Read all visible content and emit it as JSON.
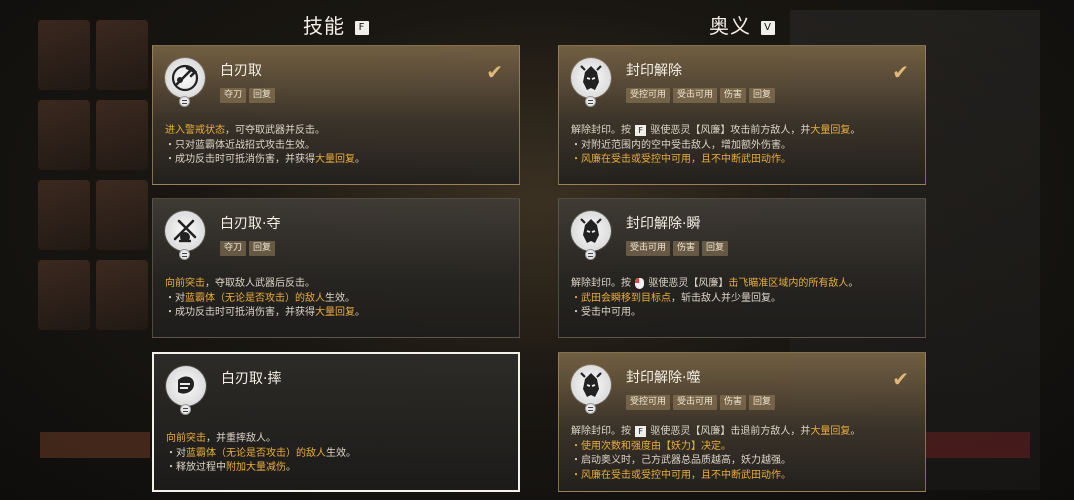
{
  "headers": {
    "skills": {
      "label": "技能",
      "key": "F"
    },
    "arcana": {
      "label": "奥义",
      "key": "V"
    }
  },
  "colors": {
    "gold": "#e9ae3c",
    "blue": "#7fb3e6",
    "check": "#e0b97a"
  },
  "skills": [
    {
      "title": "白刃取",
      "tags": [
        "夺刀",
        "回复"
      ],
      "selected": true,
      "icon": "blade-grab-icon",
      "lines": [
        [
          {
            "t": "进入警戒状态",
            "c": "gold"
          },
          {
            "t": "，可夺取武器并反击。"
          }
        ],
        [
          {
            "t": "・只对蓝霸体近战招式攻击生效。"
          }
        ],
        [
          {
            "t": "・成功反击时可抵消伤害，并获得"
          },
          {
            "t": "大量回复",
            "c": "gold"
          },
          {
            "t": "。"
          }
        ]
      ]
    },
    {
      "title": "白刃取·夺",
      "tags": [
        "夺刀",
        "回复"
      ],
      "selected": false,
      "icon": "blade-snatch-icon",
      "lines": [
        [
          {
            "t": "向前突击",
            "c": "gold"
          },
          {
            "t": "，夺取敌人武器后反击。"
          }
        ],
        [
          {
            "t": "・对"
          },
          {
            "t": "蓝霸体（无论是否攻击）的敌人",
            "c": "gold"
          },
          {
            "t": "生效。"
          }
        ],
        [
          {
            "t": "・成功反击时可抵消伤害，并获得"
          },
          {
            "t": "大量回复",
            "c": "gold"
          },
          {
            "t": "。"
          }
        ]
      ]
    },
    {
      "title": "白刃取·摔",
      "tags": [],
      "selected": false,
      "focused": true,
      "icon": "blade-throw-icon",
      "lines": [
        [
          {
            "t": "向前突击",
            "c": "gold"
          },
          {
            "t": "，并重摔敌人。"
          }
        ],
        [
          {
            "t": "・对"
          },
          {
            "t": "蓝霸体（无论是否攻击）的敌人",
            "c": "gold"
          },
          {
            "t": "生效。"
          }
        ],
        [
          {
            "t": "・释放过程中"
          },
          {
            "t": "附加大量减伤",
            "c": "gold"
          },
          {
            "t": "。"
          }
        ]
      ]
    }
  ],
  "arcana": [
    {
      "title": "封印解除",
      "tags": [
        "受控可用",
        "受击可用",
        "伤害",
        "回复"
      ],
      "selected": true,
      "icon": "demon-mask-icon",
      "lines": [
        [
          {
            "t": "解除封印。按 "
          },
          {
            "k": "F"
          },
          {
            "t": " 驱使恶灵【风廉】攻击前方敌人，并"
          },
          {
            "t": "大量回复",
            "c": "gold"
          },
          {
            "t": "。"
          }
        ],
        [
          {
            "t": "・对附近范围内的空中受击敌人，增加额外伤害。"
          }
        ],
        [
          {
            "t": "・风廉在受击或受控中可用，且不中断武田动作。",
            "c": "gold"
          }
        ]
      ]
    },
    {
      "title": "封印解除·瞬",
      "tags": [
        "受击可用",
        "伤害",
        "回复"
      ],
      "selected": false,
      "icon": "demon-mask-icon",
      "lines": [
        [
          {
            "t": "解除封印。按 "
          },
          {
            "m": "mouse"
          },
          {
            "t": " 驱使恶灵【风廉】"
          },
          {
            "t": "击飞瞄准区域内的所有敌人",
            "c": "gold"
          },
          {
            "t": "。"
          }
        ],
        [
          {
            "t": "・武田会瞬移到目标点",
            "c": "gold"
          },
          {
            "t": "，斩击敌人并少量回复。"
          }
        ],
        [
          {
            "t": "・受击中可用。"
          }
        ]
      ]
    },
    {
      "title": "封印解除·噬",
      "tags": [
        "受控可用",
        "受击可用",
        "伤害",
        "回复"
      ],
      "selected": true,
      "icon": "demon-mask-icon",
      "lines": [
        [
          {
            "t": "解除封印。按 "
          },
          {
            "k": "F"
          },
          {
            "t": " 驱使恶灵【风廉】击退前方敌人，并"
          },
          {
            "t": "大量回复",
            "c": "gold"
          },
          {
            "t": "。"
          }
        ],
        [
          {
            "t": "・使用次数和强度由【妖力】决定。",
            "c": "gold"
          }
        ],
        [
          {
            "t": "・启动奥义时，己方武器总品质越高，妖力越强。"
          }
        ],
        [
          {
            "t": "・风廉在受击或受控中可用，且不中断武田动作。",
            "c": "gold"
          }
        ]
      ]
    }
  ]
}
